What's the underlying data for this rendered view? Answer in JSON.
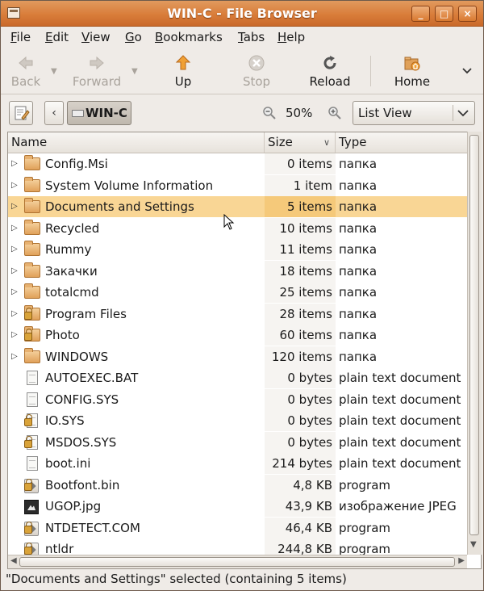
{
  "window": {
    "title": "WIN-C - File Browser",
    "controls": {
      "minimize": "_",
      "maximize": "□",
      "close": "×"
    }
  },
  "menubar": [
    "File",
    "Edit",
    "View",
    "Go",
    "Bookmarks",
    "Tabs",
    "Help"
  ],
  "toolbar": {
    "back": "Back",
    "forward": "Forward",
    "up": "Up",
    "stop": "Stop",
    "reload": "Reload",
    "home": "Home"
  },
  "location": {
    "path_button": "WIN-C",
    "zoom": "50%",
    "view_mode": "List View"
  },
  "columns": {
    "name": "Name",
    "size": "Size",
    "type": "Type"
  },
  "files": [
    {
      "name": "Config.Msi",
      "size": "0 items",
      "type": "папка",
      "kind": "folder",
      "expandable": true,
      "locked": false,
      "selected": false
    },
    {
      "name": "System Volume Information",
      "size": "1 item",
      "type": "папка",
      "kind": "folder",
      "expandable": true,
      "locked": false,
      "selected": false
    },
    {
      "name": "Documents and Settings",
      "size": "5 items",
      "type": "папка",
      "kind": "folder",
      "expandable": true,
      "locked": false,
      "selected": true
    },
    {
      "name": "Recycled",
      "size": "10 items",
      "type": "папка",
      "kind": "folder",
      "expandable": true,
      "locked": false,
      "selected": false
    },
    {
      "name": "Rummy",
      "size": "11 items",
      "type": "папка",
      "kind": "folder",
      "expandable": true,
      "locked": false,
      "selected": false
    },
    {
      "name": "Закачки",
      "size": "18 items",
      "type": "папка",
      "kind": "folder",
      "expandable": true,
      "locked": false,
      "selected": false
    },
    {
      "name": "totalcmd",
      "size": "25 items",
      "type": "папка",
      "kind": "folder",
      "expandable": true,
      "locked": false,
      "selected": false
    },
    {
      "name": "Program Files",
      "size": "28 items",
      "type": "папка",
      "kind": "folder",
      "expandable": true,
      "locked": true,
      "selected": false
    },
    {
      "name": "Photo",
      "size": "60 items",
      "type": "папка",
      "kind": "folder",
      "expandable": true,
      "locked": true,
      "selected": false
    },
    {
      "name": "WINDOWS",
      "size": "120 items",
      "type": "папка",
      "kind": "folder",
      "expandable": true,
      "locked": false,
      "selected": false
    },
    {
      "name": "AUTOEXEC.BAT",
      "size": "0 bytes",
      "type": "plain text document",
      "kind": "doc",
      "expandable": false,
      "locked": false,
      "selected": false
    },
    {
      "name": "CONFIG.SYS",
      "size": "0 bytes",
      "type": "plain text document",
      "kind": "doc",
      "expandable": false,
      "locked": false,
      "selected": false
    },
    {
      "name": "IO.SYS",
      "size": "0 bytes",
      "type": "plain text document",
      "kind": "doc",
      "expandable": false,
      "locked": true,
      "selected": false
    },
    {
      "name": "MSDOS.SYS",
      "size": "0 bytes",
      "type": "plain text document",
      "kind": "doc",
      "expandable": false,
      "locked": true,
      "selected": false
    },
    {
      "name": "boot.ini",
      "size": "214 bytes",
      "type": "plain text document",
      "kind": "doc",
      "expandable": false,
      "locked": false,
      "selected": false
    },
    {
      "name": "Bootfont.bin",
      "size": "4,8 KB",
      "type": "program",
      "kind": "program",
      "expandable": false,
      "locked": true,
      "selected": false
    },
    {
      "name": "UGOP.jpg",
      "size": "43,9 KB",
      "type": "изображение JPEG",
      "kind": "jpeg",
      "expandable": false,
      "locked": false,
      "selected": false
    },
    {
      "name": "NTDETECT.COM",
      "size": "46,4 KB",
      "type": "program",
      "kind": "program",
      "expandable": false,
      "locked": true,
      "selected": false
    },
    {
      "name": "ntldr",
      "size": "244,8 KB",
      "type": "program",
      "kind": "program",
      "expandable": false,
      "locked": true,
      "selected": false
    }
  ],
  "statusbar": "\"Documents and Settings\" selected (containing 5 items)",
  "colors": {
    "titlebar": "#d97d3a",
    "selection": "#f9d695",
    "window_bg": "#efebe7"
  },
  "icons": {
    "back": "back-arrow-icon",
    "forward": "forward-arrow-icon",
    "up": "up-arrow-icon",
    "stop": "stop-icon",
    "reload": "reload-icon",
    "home": "home-icon",
    "folder": "folder-icon",
    "document": "document-icon",
    "program": "program-icon",
    "image": "image-icon",
    "lock": "lock-icon"
  }
}
